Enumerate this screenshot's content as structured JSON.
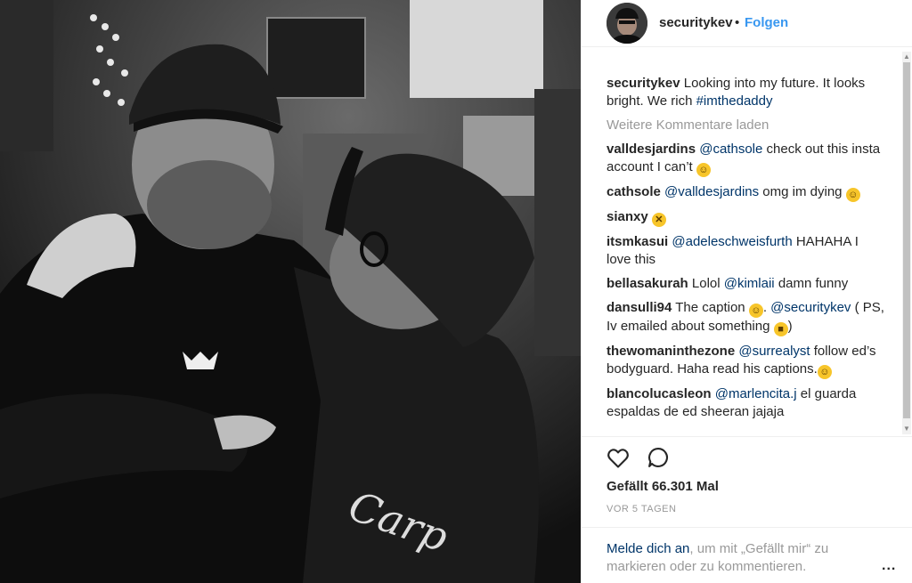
{
  "header": {
    "username": "securitykev",
    "separator": "•",
    "follow_label": "Folgen",
    "avatar_icon": "profile-avatar"
  },
  "caption": {
    "user": "securitykev",
    "text": "Looking into my future. It looks bright. We rich ",
    "hashtag": "#imthedaddy"
  },
  "load_more_label": "Weitere Kommentare laden",
  "comments": [
    {
      "user": "valldesjardins",
      "mention": "@cathsole",
      "text": " check out this insta account I can’t ",
      "emoji": "grinning-sweat-emoji"
    },
    {
      "user": "cathsole",
      "mention": "@valldesjardins",
      "text": " omg im dying ",
      "emoji": "grinning-sweat-emoji"
    },
    {
      "user": "sianxy",
      "emoji": "confounded-face-emoji"
    },
    {
      "user": "itsmkasui",
      "mention": "@adeleschweisfurth",
      "text": " HAHAHA I love this"
    },
    {
      "user": "bellasakurah",
      "text_before": "Lolol ",
      "mention": "@kimlaii",
      "text": " damn funny"
    },
    {
      "user": "dansulli94",
      "text_before": "The caption ",
      "emoji": "grinning-sweat-emoji",
      "mention": "@securitykev",
      "text": " ( PS, Iv emailed about something ",
      "emoji2": "sunglasses-emoji",
      "text_after": ")"
    },
    {
      "user": "thewomaninthezone",
      "mention": "@surrealyst",
      "text": " follow ed’s bodyguard. Haha read his captions.",
      "emoji": "grinning-sweat-emoji"
    },
    {
      "user": "blancolucasleon",
      "mention": "@marlencita.j",
      "text": " el guarda espaldas de ed sheeran jajaja"
    }
  ],
  "actions": {
    "like_icon": "heart-icon",
    "comment_icon": "comment-bubble-icon"
  },
  "likes_label": "Gefällt 66.301 Mal",
  "timestamp": "VOR 5 TAGEN",
  "footer": {
    "login_link": "Melde dich an",
    "login_text": ", um mit „Gefällt mir“ zu markieren oder zu kommentieren.",
    "more_label": "..."
  },
  "colors": {
    "link": "#003569",
    "follow": "#3897f0",
    "muted": "#999999",
    "text": "#262626"
  }
}
